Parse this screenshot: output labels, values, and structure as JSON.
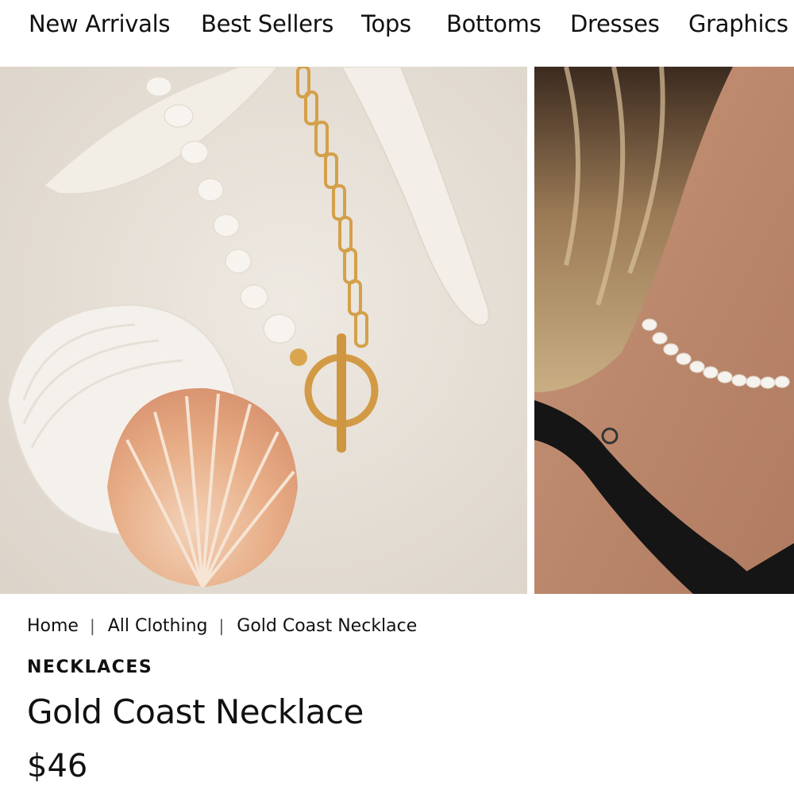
{
  "nav": {
    "items": [
      {
        "label": "New Arrivals"
      },
      {
        "label": "Best Sellers"
      },
      {
        "label": "Tops"
      },
      {
        "label": "Bottoms"
      },
      {
        "label": "Dresses"
      },
      {
        "label": "Graphics"
      }
    ]
  },
  "gallery": {
    "images": [
      {
        "icon": "necklace-on-sand-photo"
      },
      {
        "icon": "model-wearing-pearl-necklace-photo"
      }
    ]
  },
  "breadcrumb": {
    "items": [
      {
        "label": "Home"
      },
      {
        "label": "All Clothing"
      },
      {
        "label": "Gold Coast Necklace"
      }
    ],
    "separator": "|"
  },
  "product": {
    "category": "NECKLACES",
    "title": "Gold Coast Necklace",
    "price": "$46"
  },
  "colors": {
    "text": "#111111",
    "background": "#ffffff",
    "sand": "#e8e2da",
    "gold": "#d4a04a"
  }
}
